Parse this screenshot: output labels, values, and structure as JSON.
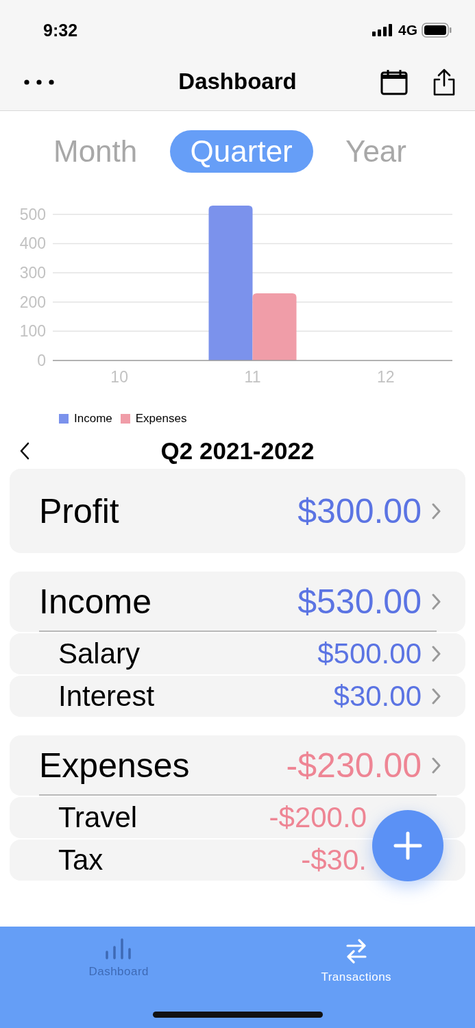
{
  "status_bar": {
    "time": "9:32",
    "network": "4G"
  },
  "nav": {
    "title": "Dashboard"
  },
  "segments": [
    {
      "label": "Month",
      "selected": false
    },
    {
      "label": "Quarter",
      "selected": true
    },
    {
      "label": "Year",
      "selected": false
    }
  ],
  "chart": {
    "chart_data": {
      "type": "bar",
      "categories": [
        "10",
        "11",
        "12"
      ],
      "series": [
        {
          "name": "Income",
          "color": "#7b92ec",
          "values": [
            0,
            530,
            0
          ]
        },
        {
          "name": "Expenses",
          "color": "#f09da8",
          "values": [
            0,
            230,
            0
          ]
        }
      ],
      "ylim": [
        0,
        530
      ],
      "yticks": [
        0,
        100,
        200,
        300,
        400,
        500
      ],
      "grid": true
    }
  },
  "period": {
    "title": "Q2 2021-2022"
  },
  "profit": {
    "label": "Profit",
    "amount": "$300.00",
    "color": "#5b74e3"
  },
  "groups": [
    {
      "label": "Income",
      "amount": "$530.00",
      "color": "#5b74e3",
      "items": [
        {
          "label": "Salary",
          "amount": "$500.00"
        },
        {
          "label": "Interest",
          "amount": "$30.00"
        }
      ]
    },
    {
      "label": "Expenses",
      "amount": "-$230.00",
      "color": "#ee8594",
      "items": [
        {
          "label": "Travel",
          "amount": "-$200.0"
        },
        {
          "label": "Tax",
          "amount": "-$30."
        }
      ]
    }
  ],
  "tab_bar": [
    {
      "label": "Dashboard",
      "kind": "chart",
      "selected": true
    },
    {
      "label": "Transactions",
      "kind": "transfer",
      "selected": false
    }
  ]
}
